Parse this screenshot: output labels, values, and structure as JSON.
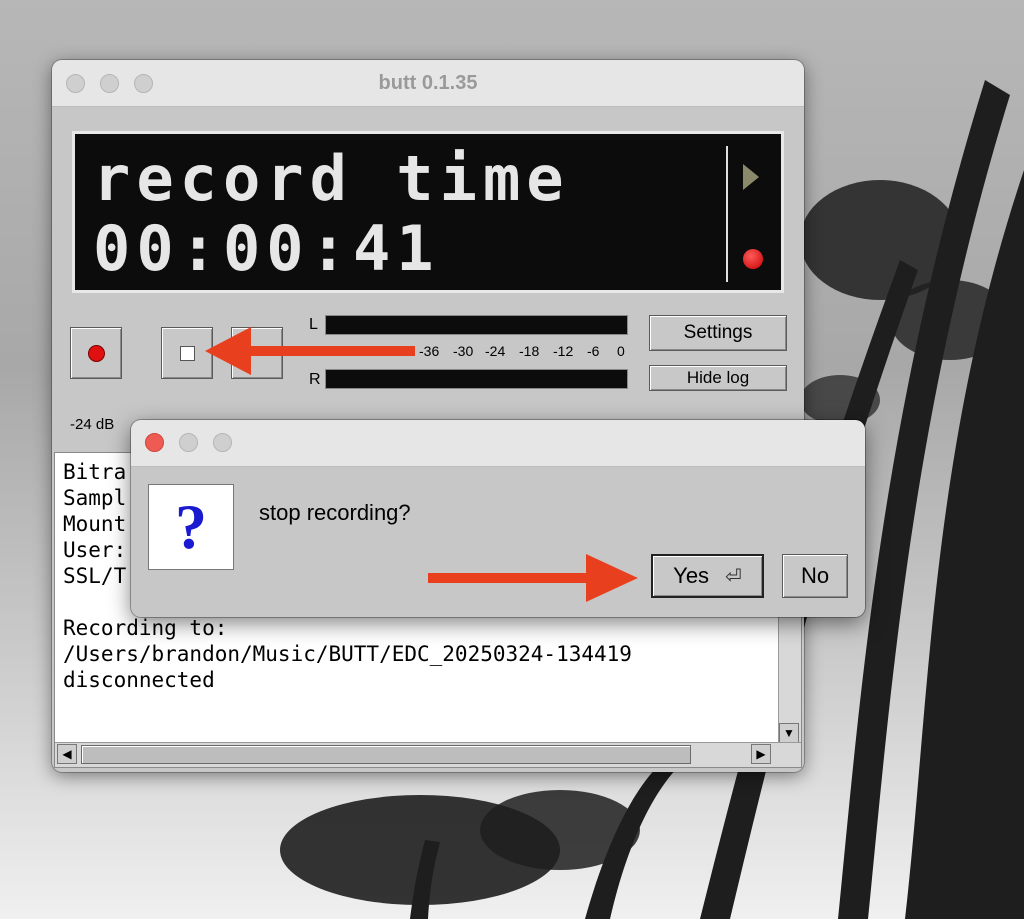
{
  "window": {
    "title": "butt 0.1.35",
    "lcd_line1": "record time",
    "lcd_line2": "00:00:41"
  },
  "controls": {
    "settings_label": "Settings",
    "hide_log_label": "Hide log",
    "meter_top_label": "L",
    "meter_bottom_label": "R",
    "meter_scale": [
      "-36",
      "-30",
      "-24",
      "-18",
      "-12",
      "-6",
      "0"
    ],
    "volume_label": "-24 dB"
  },
  "log": {
    "lines": [
      "Bitra",
      "Sampl",
      "Mount",
      "User:",
      "SSL/T",
      "",
      "Recording to:",
      "/Users/brandon/Music/BUTT/EDC_20250324-134419",
      "disconnected"
    ]
  },
  "dialog": {
    "icon_glyph": "?",
    "message": "stop recording?",
    "yes_label": "Yes",
    "no_label": "No"
  },
  "colors": {
    "annotation_arrow": "#e8401f",
    "record_red": "#e01010",
    "question_blue": "#1a1ad0"
  }
}
